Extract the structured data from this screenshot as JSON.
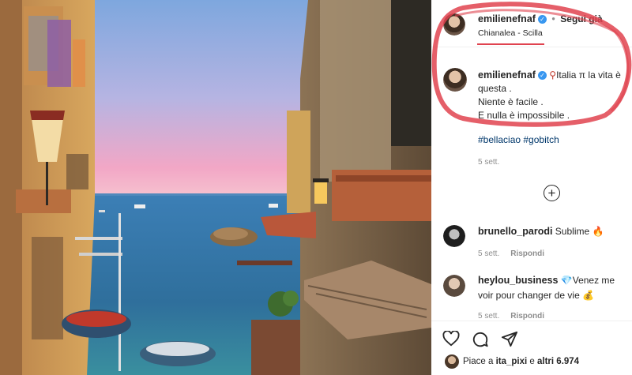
{
  "post": {
    "author": "emilienefnaf",
    "separator": "•",
    "follow_label": "Segui già",
    "location": "Chianalea - Scilla",
    "verified_glyph": "✓"
  },
  "caption": {
    "author": "emilienefnaf",
    "pin_icon": "round-pushpin-icon",
    "line1": "Italia",
    "pi_symbol": "π",
    "line1b": "la vita è questa .",
    "line2": "Niente è facile .",
    "line3": "E nulla è impossibile .",
    "hashtags": "#bellaciao #gobitch",
    "time": "5 sett."
  },
  "more_comments_icon": "plus-circle-icon",
  "comments": [
    {
      "user": "brunello_parodi",
      "text": "Sublime",
      "emoji": "🔥",
      "time": "5 sett.",
      "reply": "Rispondi"
    },
    {
      "user": "heylou_business",
      "emoji_before": "💎",
      "text": "Venez me voir pour changer de vie",
      "emoji": "💰",
      "time": "5 sett.",
      "reply": "Rispondi"
    }
  ],
  "actions": {
    "like_icon": "heart-icon",
    "comment_icon": "comment-icon",
    "share_icon": "paper-plane-icon"
  },
  "likes": {
    "prefix": "Piace a",
    "user": "ita_pixi",
    "middle": "e",
    "count_label": "altri 6.974"
  },
  "colors": {
    "link": "#00376b",
    "verified": "#3897f0",
    "annotation_red": "#e0434f",
    "sky_top": "#8fb4e4",
    "sky_bottom": "#f2a4c4",
    "sea": "#3b7fb4"
  }
}
